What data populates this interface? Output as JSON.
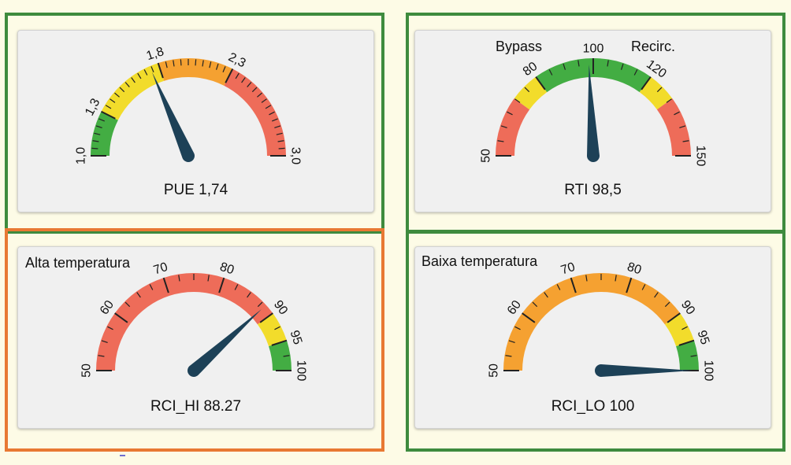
{
  "colors": {
    "frame_green": "#3e8b3e",
    "frame_orange": "#e87933",
    "zone_green": "#43ad43",
    "zone_yellow": "#f2dc2b",
    "zone_orange": "#f5a131",
    "zone_red": "#ee6c59",
    "needle": "#1d4157",
    "tick": "#222222"
  },
  "gauges": [
    {
      "id": "pue",
      "label": "PUE 1,74",
      "min": 1.0,
      "max": 3.0,
      "value": 1.74,
      "major_ticks": [
        {
          "value": 1.0,
          "label": "1,0"
        },
        {
          "value": 1.3,
          "label": "1,3"
        },
        {
          "value": 1.8,
          "label": "1,8"
        },
        {
          "value": 2.3,
          "label": "2,3"
        },
        {
          "value": 3.0,
          "label": "3,0"
        }
      ],
      "minor_step": 0.05,
      "bands": [
        {
          "from": 1.0,
          "to": 1.3,
          "color": "green"
        },
        {
          "from": 1.3,
          "to": 1.8,
          "color": "yellow"
        },
        {
          "from": 1.8,
          "to": 2.3,
          "color": "orange"
        },
        {
          "from": 2.3,
          "to": 3.0,
          "color": "red"
        }
      ]
    },
    {
      "id": "rti",
      "label": "RTI 98,5",
      "corner_left": "Bypass",
      "corner_right": "Recirc.",
      "min": 50,
      "max": 150,
      "value": 98.5,
      "major_ticks": [
        {
          "value": 50,
          "label": "50"
        },
        {
          "value": 80,
          "label": "80"
        },
        {
          "value": 100,
          "label": "100"
        },
        {
          "value": 120,
          "label": "120"
        },
        {
          "value": 150,
          "label": "150"
        }
      ],
      "minor_step": 5,
      "bands": [
        {
          "from": 50,
          "to": 70,
          "color": "red"
        },
        {
          "from": 70,
          "to": 80,
          "color": "yellow"
        },
        {
          "from": 80,
          "to": 120,
          "color": "green"
        },
        {
          "from": 120,
          "to": 130,
          "color": "yellow"
        },
        {
          "from": 130,
          "to": 150,
          "color": "red"
        }
      ]
    },
    {
      "id": "rci_hi",
      "label": "RCI_HI 88.27",
      "corner_left": "Alta temperatura",
      "min": 50,
      "max": 100,
      "value": 88.27,
      "major_ticks": [
        {
          "value": 50,
          "label": "50"
        },
        {
          "value": 60,
          "label": "60"
        },
        {
          "value": 70,
          "label": "70"
        },
        {
          "value": 80,
          "label": "80"
        },
        {
          "value": 90,
          "label": "90"
        },
        {
          "value": 95,
          "label": "95"
        },
        {
          "value": 100,
          "label": "100"
        }
      ],
      "minor_step": 2.5,
      "bands": [
        {
          "from": 50,
          "to": 90,
          "color": "red"
        },
        {
          "from": 90,
          "to": 95,
          "color": "yellow"
        },
        {
          "from": 95,
          "to": 100,
          "color": "green"
        }
      ]
    },
    {
      "id": "rci_lo",
      "label": "RCI_LO 100",
      "corner_left": "Baixa temperatura",
      "min": 50,
      "max": 100,
      "value": 100,
      "major_ticks": [
        {
          "value": 50,
          "label": "50"
        },
        {
          "value": 60,
          "label": "60"
        },
        {
          "value": 70,
          "label": "70"
        },
        {
          "value": 80,
          "label": "80"
        },
        {
          "value": 90,
          "label": "90"
        },
        {
          "value": 95,
          "label": "95"
        },
        {
          "value": 100,
          "label": "100"
        }
      ],
      "minor_step": 2.5,
      "bands": [
        {
          "from": 50,
          "to": 90,
          "color": "orange"
        },
        {
          "from": 90,
          "to": 95,
          "color": "yellow"
        },
        {
          "from": 95,
          "to": 100,
          "color": "green"
        }
      ]
    }
  ]
}
